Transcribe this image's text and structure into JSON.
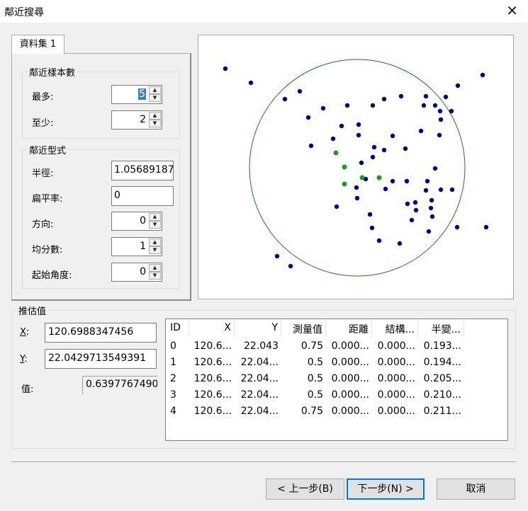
{
  "window": {
    "title": "鄰近搜尋"
  },
  "tab": {
    "label": "資料集 1"
  },
  "sample_group": {
    "title": "鄰近樣本數",
    "max_label": "最多:",
    "max_value": "5",
    "min_label": "至少:",
    "min_value": "2"
  },
  "shape_group": {
    "title": "鄰近型式",
    "radius_label": "半徑:",
    "radius_value": "1.05689187",
    "flatten_label": "扁平率:",
    "flatten_value": "0",
    "direction_label": "方向:",
    "direction_value": "0",
    "sectors_label": "均分數:",
    "sectors_value": "1",
    "start_angle_label": "起始角度:",
    "start_angle_value": "0"
  },
  "estimate": {
    "title": "推估值",
    "x_label": "X",
    "x_value": "120.6988347456",
    "y_label": "Y",
    "y_value": "22.0429713549391",
    "value_label": "值:",
    "value_value": "0.6397767490"
  },
  "table": {
    "headers": [
      "ID",
      "X",
      "Y",
      "測量值",
      "距離",
      "結構...",
      "半變..."
    ],
    "rows": [
      [
        "0",
        "120.6...",
        "22.043",
        "0.75",
        "0.000...",
        "0.000...",
        "0.193..."
      ],
      [
        "1",
        "120.6...",
        "22.04...",
        "0.5",
        "0.000...",
        "0.000...",
        "0.194..."
      ],
      [
        "2",
        "120.6...",
        "22.04...",
        "0.5",
        "0.000...",
        "0.000...",
        "0.205..."
      ],
      [
        "3",
        "120.6...",
        "22.04...",
        "0.5",
        "0.000...",
        "0.000...",
        "0.210..."
      ],
      [
        "4",
        "120.6...",
        "22.04...",
        "0.75",
        "0.000...",
        "0.000...",
        "0.211..."
      ]
    ]
  },
  "buttons": {
    "back": "< 上一步(B)",
    "next": "下一步(N) >",
    "cancel": "取消"
  },
  "colors": {
    "neighbor_point": "#1a9e1a",
    "other_point": "#00008b",
    "search_circle": "#1a7a1a"
  }
}
